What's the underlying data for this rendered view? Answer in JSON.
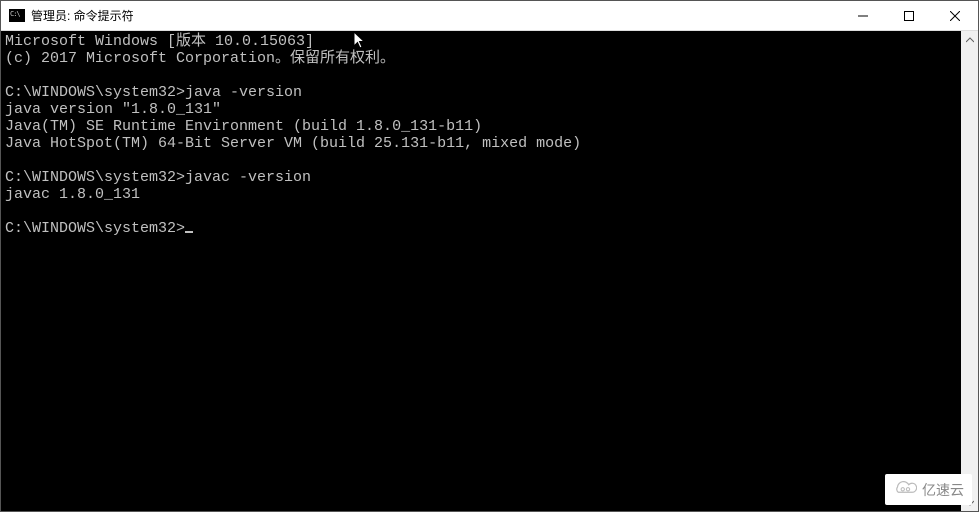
{
  "window": {
    "title": "管理员: 命令提示符"
  },
  "terminal": {
    "line1": "Microsoft Windows [版本 10.0.15063]",
    "line2": "(c) 2017 Microsoft Corporation。保留所有权利。",
    "blank1": "",
    "prompt1": "C:\\WINDOWS\\system32>java -version",
    "out1a": "java version \"1.8.0_131\"",
    "out1b": "Java(TM) SE Runtime Environment (build 1.8.0_131-b11)",
    "out1c": "Java HotSpot(TM) 64-Bit Server VM (build 25.131-b11, mixed mode)",
    "blank2": "",
    "prompt2": "C:\\WINDOWS\\system32>javac -version",
    "out2a": "javac 1.8.0_131",
    "blank3": "",
    "prompt3": "C:\\WINDOWS\\system32>"
  },
  "watermark": {
    "text": "亿速云"
  }
}
